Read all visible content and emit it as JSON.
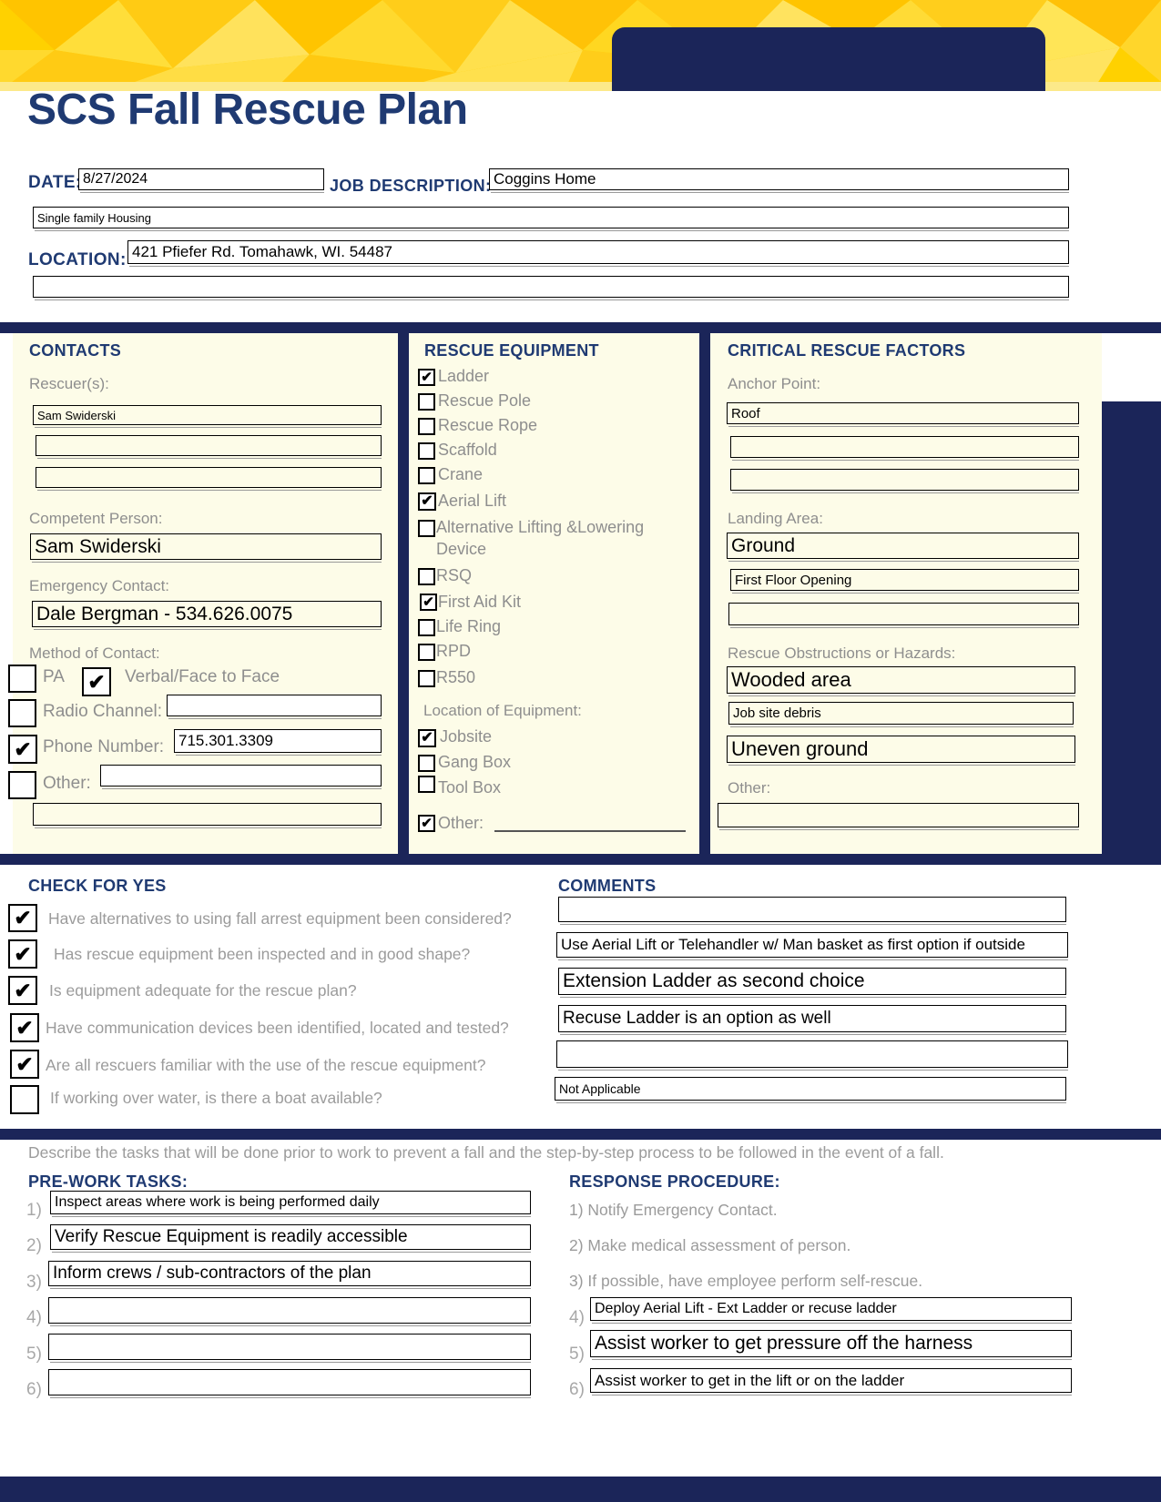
{
  "header": {
    "title": "SCS Fall Rescue Plan",
    "logo_placeholder": "",
    "accent_yellow": "#FFD100",
    "accent_navy": "#1B2559",
    "title_color": "#1F3A72"
  },
  "top_fields": {
    "date_label": "DATE:",
    "date_value": "8/27/2024",
    "job_description_label": "JOB DESCRIPTION:",
    "job_description_value": "Coggins Home",
    "job_description_value2": "Single family Housing",
    "location_label": "LOCATION:",
    "location_value": "421 Pfiefer Rd.  Tomahawk, WI. 54487",
    "location_value2": ""
  },
  "contacts": {
    "title": "CONTACTS",
    "rescuers_label": "Rescuer(s):",
    "rescuers": [
      "Sam Swiderski",
      "",
      ""
    ],
    "competent_person_label": "Competent Person:",
    "competent_person": "Sam Swiderski",
    "emergency_contact_label": "Emergency Contact:",
    "emergency_contact": "Dale Bergman - 534.626.0075",
    "method_label": "Method of Contact:",
    "methods": [
      {
        "label": "PA",
        "checked": false
      },
      {
        "label": "Verbal/Face to Face",
        "checked": true
      },
      {
        "label": "Radio Channel:",
        "checked": false,
        "value": ""
      },
      {
        "label": "Phone Number:",
        "checked": true,
        "value": "715.301.3309"
      },
      {
        "label": "Other:",
        "checked": false,
        "value": ""
      }
    ],
    "extra_value": ""
  },
  "rescue_equipment": {
    "title": "RESCUE EQUIPMENT",
    "items": [
      {
        "label": "Ladder",
        "checked": true
      },
      {
        "label": "Rescue Pole",
        "checked": false
      },
      {
        "label": "Rescue Rope",
        "checked": false
      },
      {
        "label": "Scaffold",
        "checked": false
      },
      {
        "label": "Crane",
        "checked": false
      },
      {
        "label": "Aerial Lift",
        "checked": true
      },
      {
        "label": "Alternative Lifting &Lowering",
        "label2": "Device",
        "checked": false
      },
      {
        "label": "RSQ",
        "checked": false
      },
      {
        "label": "First Aid Kit",
        "checked": true
      },
      {
        "label": "Life Ring",
        "checked": false
      },
      {
        "label": "RPD",
        "checked": false
      },
      {
        "label": "R550",
        "checked": false
      }
    ],
    "location_label": "Location of Equipment:",
    "locations": [
      {
        "label": "Jobsite",
        "checked": true
      },
      {
        "label": "Gang Box",
        "checked": false
      },
      {
        "label": "Tool Box",
        "checked": false
      },
      {
        "label": "Other:",
        "checked": true,
        "value": ""
      }
    ]
  },
  "critical_factors": {
    "title": "CRITICAL RESCUE FACTORS",
    "anchor_point_label": "Anchor Point:",
    "anchor_points": [
      "Roof",
      "",
      ""
    ],
    "landing_area_label": "Landing Area:",
    "landing_areas": [
      "Ground",
      "First Floor Opening",
      ""
    ],
    "obstructions_label": "Rescue Obstructions or Hazards:",
    "obstructions": [
      "Wooded area",
      "Job site debris",
      "Uneven ground"
    ],
    "other_label": "Other:",
    "other_value": ""
  },
  "check_for_yes": {
    "title": "CHECK FOR YES",
    "questions": [
      {
        "text": "Have alternatives to using fall arrest equipment been considered?",
        "checked": true
      },
      {
        "text": "Has rescue equipment been inspected and in good shape?",
        "checked": true
      },
      {
        "text": "Is equipment adequate for the rescue plan?",
        "checked": true
      },
      {
        "text": "Have communication devices been identified, located and tested?",
        "checked": true
      },
      {
        "text": "Are all rescuers familiar with the use of the rescue equipment?",
        "checked": true
      },
      {
        "text": "If working over water, is there a boat available?",
        "checked": false
      }
    ]
  },
  "comments": {
    "title": "COMMENTS",
    "rows": [
      "",
      "Use Aerial Lift or Telehandler w/ Man basket as first option if outside",
      "Extension Ladder as second choice",
      "Recuse Ladder is an option as well",
      "",
      "Not Applicable"
    ]
  },
  "bottom": {
    "description": "Describe the tasks that will be done prior to work to prevent a fall and the step-by-step process to be followed in the event of a fall.",
    "pre_work_title": "PRE-WORK TASKS:",
    "pre_work_items": [
      {
        "num": "1)",
        "text": "Inspect areas where work is being performed daily"
      },
      {
        "num": "2)",
        "text": "Verify Rescue Equipment is readily accessible"
      },
      {
        "num": "3)",
        "text": "Inform crews / sub-contractors of the plan"
      },
      {
        "num": "4)",
        "text": ""
      },
      {
        "num": "5)",
        "text": ""
      },
      {
        "num": "6)",
        "text": ""
      }
    ],
    "response_title": "RESPONSE PROCEDURE:",
    "response_static": [
      "1) Notify Emergency Contact.",
      "2) Make medical assessment of person.",
      "3) If possible, have employee perform self-rescue."
    ],
    "response_items": [
      {
        "num": "4)",
        "text": "Deploy Aerial Lift - Ext Ladder or recuse ladder"
      },
      {
        "num": "5)",
        "text": "Assist worker to get pressure off the harness"
      },
      {
        "num": "6)",
        "text": "Assist worker to get in the lift or on the ladder"
      }
    ]
  },
  "glyphs": {
    "check": "✔"
  }
}
